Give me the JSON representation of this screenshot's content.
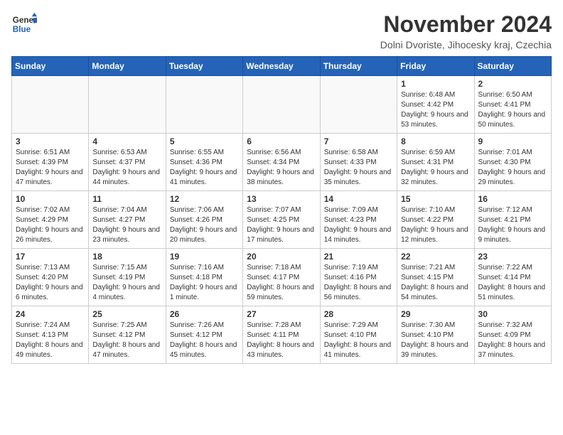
{
  "logo": {
    "line1": "General",
    "line2": "Blue"
  },
  "title": "November 2024",
  "location": "Dolni Dvoriste, Jihocesky kraj, Czechia",
  "headers": [
    "Sunday",
    "Monday",
    "Tuesday",
    "Wednesday",
    "Thursday",
    "Friday",
    "Saturday"
  ],
  "weeks": [
    [
      {
        "day": "",
        "sunrise": "",
        "sunset": "",
        "daylight": ""
      },
      {
        "day": "",
        "sunrise": "",
        "sunset": "",
        "daylight": ""
      },
      {
        "day": "",
        "sunrise": "",
        "sunset": "",
        "daylight": ""
      },
      {
        "day": "",
        "sunrise": "",
        "sunset": "",
        "daylight": ""
      },
      {
        "day": "",
        "sunrise": "",
        "sunset": "",
        "daylight": ""
      },
      {
        "day": "1",
        "sunrise": "Sunrise: 6:48 AM",
        "sunset": "Sunset: 4:42 PM",
        "daylight": "Daylight: 9 hours and 53 minutes."
      },
      {
        "day": "2",
        "sunrise": "Sunrise: 6:50 AM",
        "sunset": "Sunset: 4:41 PM",
        "daylight": "Daylight: 9 hours and 50 minutes."
      }
    ],
    [
      {
        "day": "3",
        "sunrise": "Sunrise: 6:51 AM",
        "sunset": "Sunset: 4:39 PM",
        "daylight": "Daylight: 9 hours and 47 minutes."
      },
      {
        "day": "4",
        "sunrise": "Sunrise: 6:53 AM",
        "sunset": "Sunset: 4:37 PM",
        "daylight": "Daylight: 9 hours and 44 minutes."
      },
      {
        "day": "5",
        "sunrise": "Sunrise: 6:55 AM",
        "sunset": "Sunset: 4:36 PM",
        "daylight": "Daylight: 9 hours and 41 minutes."
      },
      {
        "day": "6",
        "sunrise": "Sunrise: 6:56 AM",
        "sunset": "Sunset: 4:34 PM",
        "daylight": "Daylight: 9 hours and 38 minutes."
      },
      {
        "day": "7",
        "sunrise": "Sunrise: 6:58 AM",
        "sunset": "Sunset: 4:33 PM",
        "daylight": "Daylight: 9 hours and 35 minutes."
      },
      {
        "day": "8",
        "sunrise": "Sunrise: 6:59 AM",
        "sunset": "Sunset: 4:31 PM",
        "daylight": "Daylight: 9 hours and 32 minutes."
      },
      {
        "day": "9",
        "sunrise": "Sunrise: 7:01 AM",
        "sunset": "Sunset: 4:30 PM",
        "daylight": "Daylight: 9 hours and 29 minutes."
      }
    ],
    [
      {
        "day": "10",
        "sunrise": "Sunrise: 7:02 AM",
        "sunset": "Sunset: 4:29 PM",
        "daylight": "Daylight: 9 hours and 26 minutes."
      },
      {
        "day": "11",
        "sunrise": "Sunrise: 7:04 AM",
        "sunset": "Sunset: 4:27 PM",
        "daylight": "Daylight: 9 hours and 23 minutes."
      },
      {
        "day": "12",
        "sunrise": "Sunrise: 7:06 AM",
        "sunset": "Sunset: 4:26 PM",
        "daylight": "Daylight: 9 hours and 20 minutes."
      },
      {
        "day": "13",
        "sunrise": "Sunrise: 7:07 AM",
        "sunset": "Sunset: 4:25 PM",
        "daylight": "Daylight: 9 hours and 17 minutes."
      },
      {
        "day": "14",
        "sunrise": "Sunrise: 7:09 AM",
        "sunset": "Sunset: 4:23 PM",
        "daylight": "Daylight: 9 hours and 14 minutes."
      },
      {
        "day": "15",
        "sunrise": "Sunrise: 7:10 AM",
        "sunset": "Sunset: 4:22 PM",
        "daylight": "Daylight: 9 hours and 12 minutes."
      },
      {
        "day": "16",
        "sunrise": "Sunrise: 7:12 AM",
        "sunset": "Sunset: 4:21 PM",
        "daylight": "Daylight: 9 hours and 9 minutes."
      }
    ],
    [
      {
        "day": "17",
        "sunrise": "Sunrise: 7:13 AM",
        "sunset": "Sunset: 4:20 PM",
        "daylight": "Daylight: 9 hours and 6 minutes."
      },
      {
        "day": "18",
        "sunrise": "Sunrise: 7:15 AM",
        "sunset": "Sunset: 4:19 PM",
        "daylight": "Daylight: 9 hours and 4 minutes."
      },
      {
        "day": "19",
        "sunrise": "Sunrise: 7:16 AM",
        "sunset": "Sunset: 4:18 PM",
        "daylight": "Daylight: 9 hours and 1 minute."
      },
      {
        "day": "20",
        "sunrise": "Sunrise: 7:18 AM",
        "sunset": "Sunset: 4:17 PM",
        "daylight": "Daylight: 8 hours and 59 minutes."
      },
      {
        "day": "21",
        "sunrise": "Sunrise: 7:19 AM",
        "sunset": "Sunset: 4:16 PM",
        "daylight": "Daylight: 8 hours and 56 minutes."
      },
      {
        "day": "22",
        "sunrise": "Sunrise: 7:21 AM",
        "sunset": "Sunset: 4:15 PM",
        "daylight": "Daylight: 8 hours and 54 minutes."
      },
      {
        "day": "23",
        "sunrise": "Sunrise: 7:22 AM",
        "sunset": "Sunset: 4:14 PM",
        "daylight": "Daylight: 8 hours and 51 minutes."
      }
    ],
    [
      {
        "day": "24",
        "sunrise": "Sunrise: 7:24 AM",
        "sunset": "Sunset: 4:13 PM",
        "daylight": "Daylight: 8 hours and 49 minutes."
      },
      {
        "day": "25",
        "sunrise": "Sunrise: 7:25 AM",
        "sunset": "Sunset: 4:12 PM",
        "daylight": "Daylight: 8 hours and 47 minutes."
      },
      {
        "day": "26",
        "sunrise": "Sunrise: 7:26 AM",
        "sunset": "Sunset: 4:12 PM",
        "daylight": "Daylight: 8 hours and 45 minutes."
      },
      {
        "day": "27",
        "sunrise": "Sunrise: 7:28 AM",
        "sunset": "Sunset: 4:11 PM",
        "daylight": "Daylight: 8 hours and 43 minutes."
      },
      {
        "day": "28",
        "sunrise": "Sunrise: 7:29 AM",
        "sunset": "Sunset: 4:10 PM",
        "daylight": "Daylight: 8 hours and 41 minutes."
      },
      {
        "day": "29",
        "sunrise": "Sunrise: 7:30 AM",
        "sunset": "Sunset: 4:10 PM",
        "daylight": "Daylight: 8 hours and 39 minutes."
      },
      {
        "day": "30",
        "sunrise": "Sunrise: 7:32 AM",
        "sunset": "Sunset: 4:09 PM",
        "daylight": "Daylight: 8 hours and 37 minutes."
      }
    ]
  ]
}
